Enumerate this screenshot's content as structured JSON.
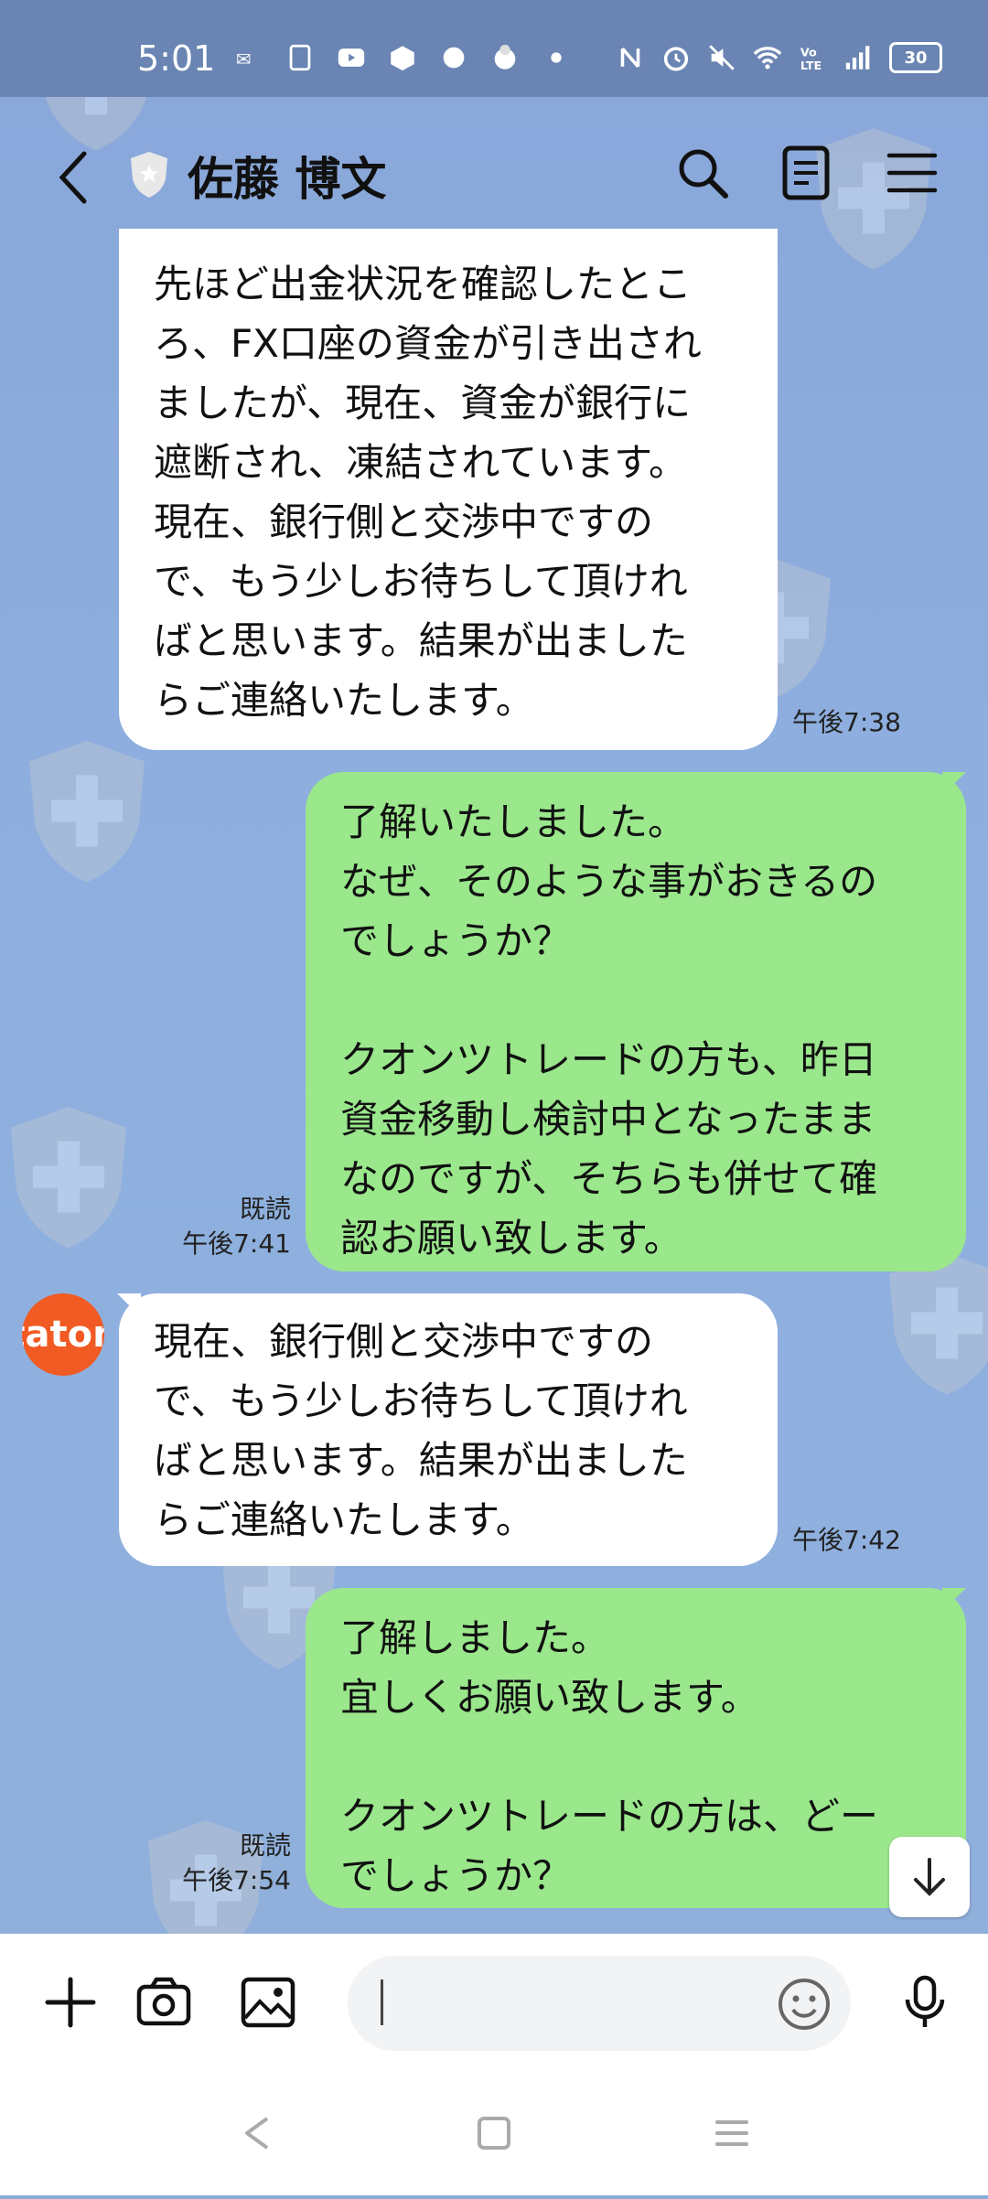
{
  "status_bar": {
    "time": "5:01",
    "battery": "30",
    "left_icons": [
      "email-icon",
      "sim-icon",
      "youtube-icon",
      "box-icon",
      "cloud-icon",
      "sheep-icon",
      "dot-icon"
    ],
    "right_icons": [
      "nfc-icon",
      "alarm-icon",
      "mute-icon",
      "wifi-icon",
      "volte-icon",
      "signal-icon"
    ]
  },
  "header": {
    "contact_name": "佐藤 博文"
  },
  "messages": [
    {
      "direction": "in",
      "text": "先ほど出金状況を確認したとこ\nろ、FX口座の資金が引き出され\nましたが、現在、資金が銀行に\n遮断され、凍結されています。\n現在、銀行側と交渉中ですの\nで、もう少しお待ちして頂けれ\nばと思います。結果が出ました\nらご連絡いたします。",
      "time": "午後7:38"
    },
    {
      "direction": "out",
      "text": "了解いたしました。\nなぜ、そのような事がおきるの\nでしょうか？\n\nクオンツトレードの方も、昨日\n資金移動し検討中となったまま\nなのですが、そちらも併せて確\n認お願い致します。",
      "read": "既読",
      "time": "午後7:41"
    },
    {
      "direction": "in",
      "text": "現在、銀行側と交渉中ですの\nで、もう少しお待ちして頂けれ\nばと思います。結果が出ました\nらご連絡いたします。",
      "time": "午後7:42"
    },
    {
      "direction": "out",
      "text": "了解しました。\n宜しくお願い致します。\n\nクオンツトレードの方は、どー\nでしょうか？",
      "read": "既読",
      "time": "午後7:54"
    }
  ],
  "avatar_text": "taton",
  "input": {
    "placeholder": ""
  },
  "colors": {
    "chat_bg": "#8aaad9",
    "outgoing_bubble": "#9ae78c",
    "incoming_bubble": "#ffffff",
    "status_bar": "#6a85b3",
    "avatar": "#f15a22"
  }
}
